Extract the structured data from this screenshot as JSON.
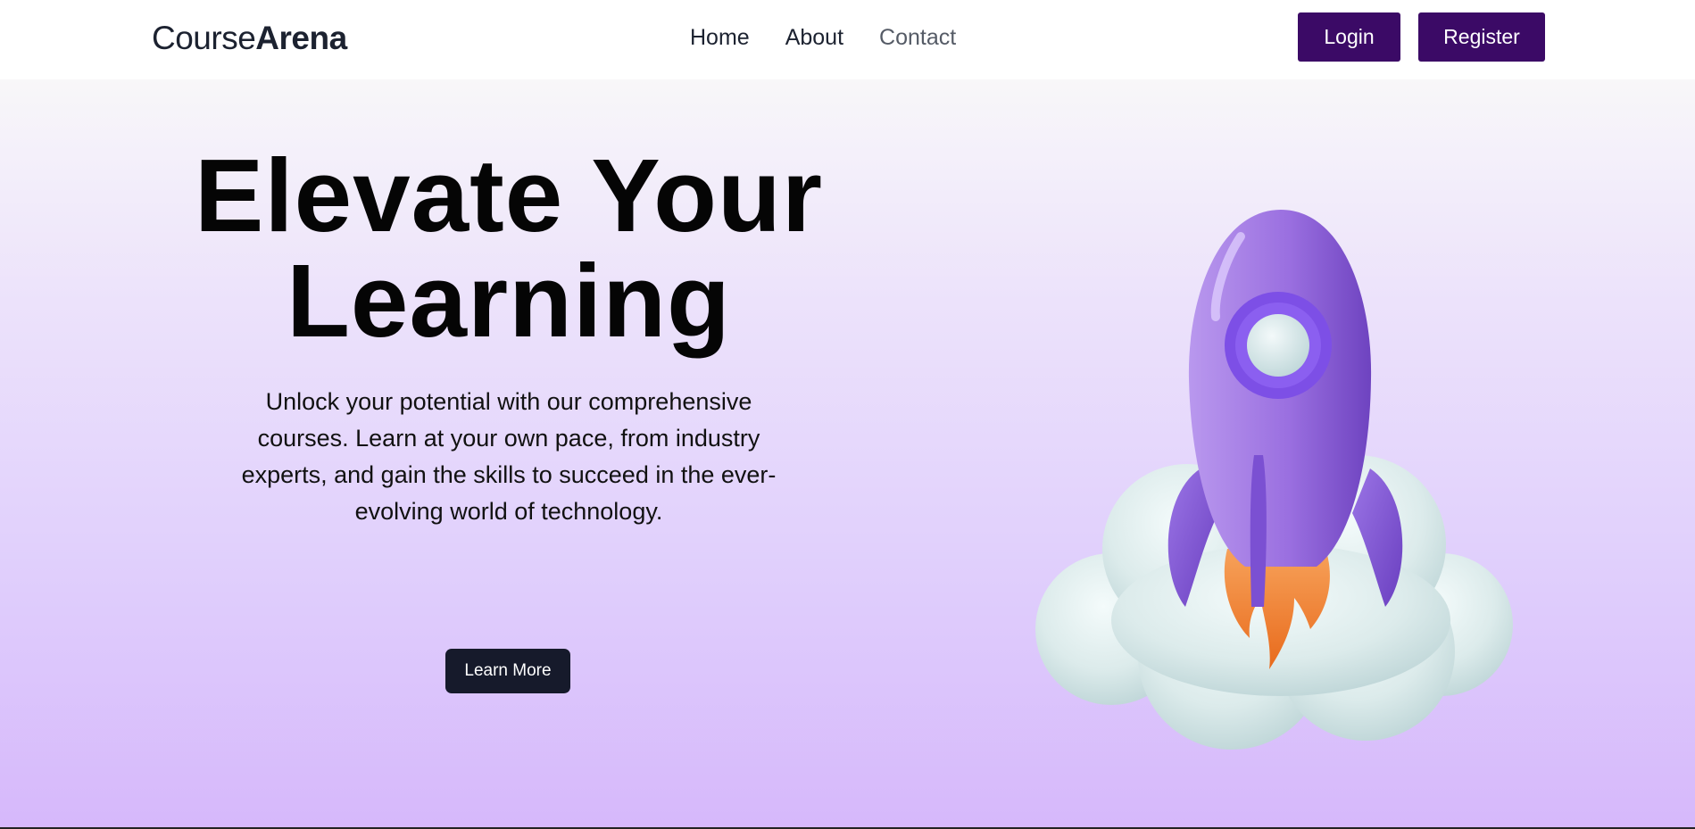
{
  "brand": {
    "name_part1": "Course",
    "name_part2": "Arena"
  },
  "nav": {
    "links": [
      {
        "label": "Home"
      },
      {
        "label": "About"
      },
      {
        "label": "Contact"
      }
    ],
    "login_label": "Login",
    "register_label": "Register"
  },
  "hero": {
    "title_line1": "Elevate Your",
    "title_line2": "Learning",
    "description": "Unlock your potential with our comprehensive courses. Learn at your own pace, from industry experts, and gain the skills to succeed in the ever-evolving world of technology.",
    "cta_label": "Learn More",
    "illustration": "rocket-launch-cloud-icon"
  },
  "colors": {
    "primary": "#3b0a66",
    "cta": "#161a2b",
    "rocket": "#9b6fe0",
    "flame": "#ef7a28",
    "cloud": "#dbe9ea"
  }
}
